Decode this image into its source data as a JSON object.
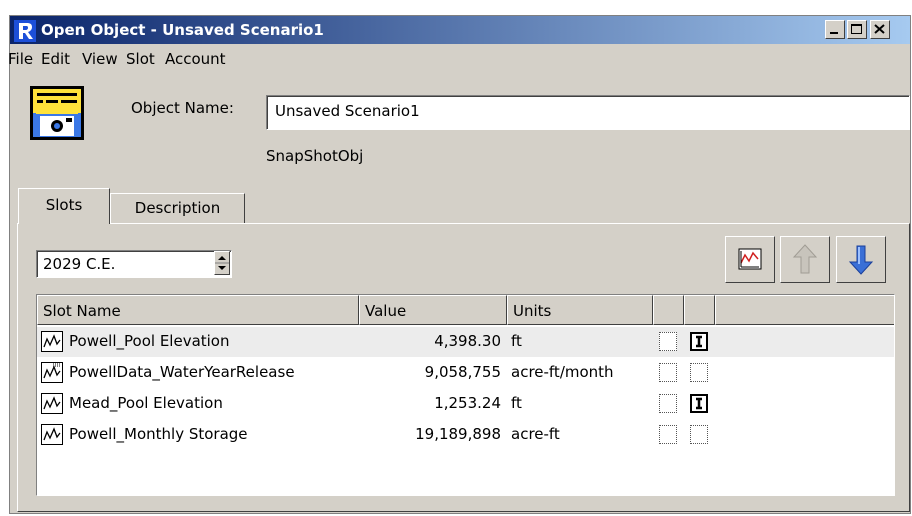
{
  "window": {
    "title": "Open Object - Unsaved Scenario1",
    "buttons": [
      "minimize",
      "maximize",
      "close"
    ]
  },
  "menu": [
    "File",
    "Edit",
    "View",
    "Slot",
    "Account"
  ],
  "object": {
    "name_label": "Object Name:",
    "name_value": "Unsaved Scenario1",
    "type": "SnapShotObj"
  },
  "tabs": [
    {
      "label": "Slots",
      "active": true
    },
    {
      "label": "Description",
      "active": false
    }
  ],
  "date": "2029 C.E.",
  "toolbar_icons": [
    "plot-icon",
    "move-up-icon",
    "move-down-icon"
  ],
  "table": {
    "headers": [
      "Slot Name",
      "Value",
      "Units"
    ],
    "rows": [
      {
        "name": "Powell_Pool Elevation",
        "value": "4,398.30",
        "units": "ft",
        "icon": "series-slot-icon",
        "flag1": "off",
        "flag2": "on",
        "selected": true
      },
      {
        "name": "PowellData_WaterYearRelease",
        "value": "9,058,755",
        "units": "acre-ft/month",
        "icon": "series-data-slot-icon",
        "flag1": "off",
        "flag2": "off",
        "selected": false
      },
      {
        "name": "Mead_Pool Elevation",
        "value": "1,253.24",
        "units": "ft",
        "icon": "series-slot-icon",
        "flag1": "off",
        "flag2": "on",
        "selected": false
      },
      {
        "name": "Powell_Monthly Storage",
        "value": "19,189,898",
        "units": "acre-ft",
        "icon": "series-slot-icon",
        "flag1": "off",
        "flag2": "off",
        "selected": false
      }
    ]
  },
  "colors": {
    "titlebar_start": "#0a246a",
    "titlebar_end": "#a6caf0",
    "window_face": "#d4d0c8",
    "down_arrow": "#3a6fd6"
  }
}
